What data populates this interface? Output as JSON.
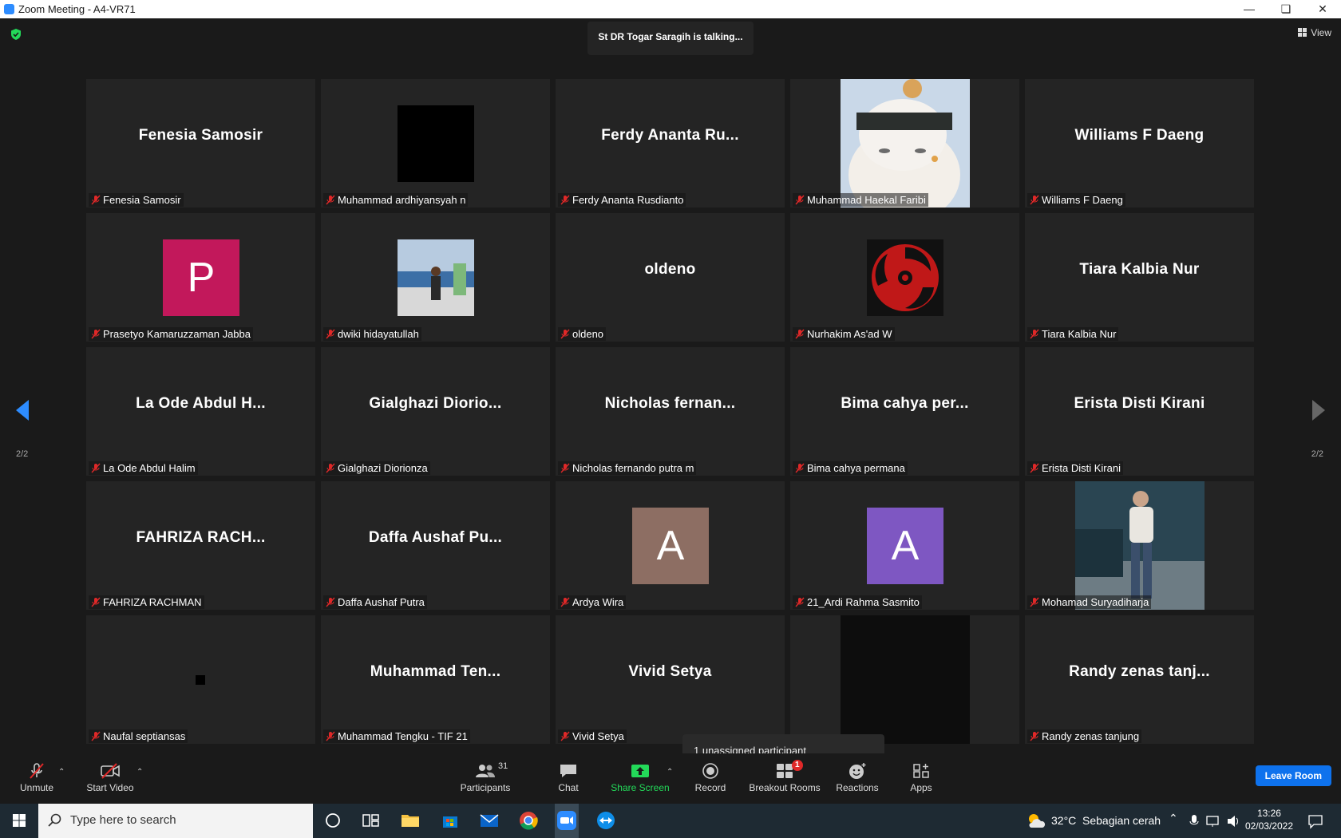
{
  "window": {
    "title": "Zoom Meeting - A4-VR71"
  },
  "meeting": {
    "talking_indicator": "St DR Togar Saragih is talking...",
    "view_label": "View",
    "page_left": "2/2",
    "page_right": "2/2",
    "tooltip": "1 unassigned participant"
  },
  "tiles": [
    {
      "display": "Fenesia Samosir",
      "name": "Fenesia Samosir"
    },
    {
      "display": "",
      "name": "Muhammad ardhiyansyah n"
    },
    {
      "display": "Ferdy Ananta Ru...",
      "name": "Ferdy Ananta Rusdianto"
    },
    {
      "display": "",
      "name": "Muhammad Haekal Faribi"
    },
    {
      "display": "Williams F Daeng",
      "name": "Williams F Daeng"
    },
    {
      "display": "P",
      "name": "Prasetyo Kamaruzzaman Jabba"
    },
    {
      "display": "",
      "name": "dwiki hidayatullah"
    },
    {
      "display": "oldeno",
      "name": "oldeno"
    },
    {
      "display": "",
      "name": "Nurhakim As'ad W"
    },
    {
      "display": "Tiara Kalbia Nur",
      "name": "Tiara Kalbia Nur"
    },
    {
      "display": "La Ode Abdul H...",
      "name": "La Ode Abdul Halim"
    },
    {
      "display": "Gialghazi Diorio...",
      "name": "Gialghazi Diorionza"
    },
    {
      "display": "Nicholas fernan...",
      "name": "Nicholas fernando putra m"
    },
    {
      "display": "Bima cahya per...",
      "name": "Bima cahya permana"
    },
    {
      "display": "Erista Disti Kirani",
      "name": "Erista Disti Kirani"
    },
    {
      "display": "FAHRIZA RACH...",
      "name": "FAHRIZA RACHMAN"
    },
    {
      "display": "Daffa Aushaf Pu...",
      "name": "Daffa Aushaf Putra"
    },
    {
      "display": "A",
      "name": "Ardya Wira"
    },
    {
      "display": "A",
      "name": "21_Ardi Rahma Sasmito"
    },
    {
      "display": "",
      "name": "Mohamad Suryadiharja"
    },
    {
      "display": "",
      "name": "Naufal septiansas"
    },
    {
      "display": "Muhammad Ten...",
      "name": "Muhammad Tengku - TIF 21"
    },
    {
      "display": "Vivid Setya",
      "name": "Vivid Setya"
    },
    {
      "display": "",
      "name": ""
    },
    {
      "display": "Randy zenas tanj...",
      "name": "Randy zenas tanjung"
    }
  ],
  "avatar_colors": {
    "P": "#c2185b",
    "A_brown": "#8d6e63",
    "A_purple": "#7e57c2"
  },
  "toolbar": {
    "unmute": "Unmute",
    "start_video": "Start Video",
    "participants": "Participants",
    "participants_count": "31",
    "chat": "Chat",
    "share_screen": "Share Screen",
    "record": "Record",
    "breakout_rooms": "Breakout Rooms",
    "breakout_badge": "1",
    "reactions": "Reactions",
    "apps": "Apps",
    "leave_room": "Leave Room"
  },
  "taskbar": {
    "search_placeholder": "Type here to search",
    "weather_temp": "32°C",
    "weather_desc": "Sebagian cerah",
    "time": "13:26",
    "date": "02/03/2022"
  }
}
